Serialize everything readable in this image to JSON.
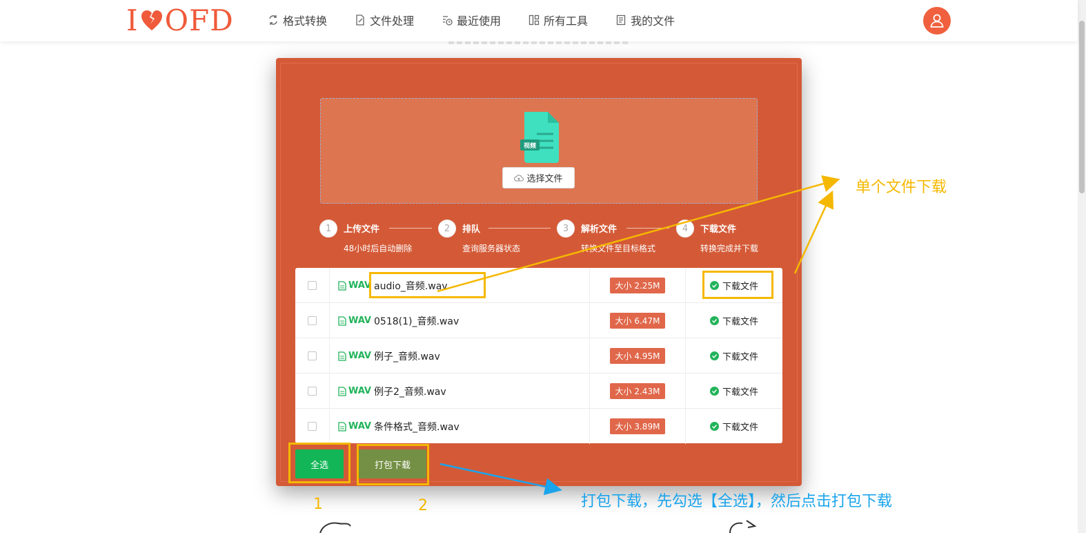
{
  "header": {
    "logo_left": "I",
    "logo_right": "OFD",
    "nav": [
      {
        "label": "格式转换",
        "icon": "convert-icon"
      },
      {
        "label": "文件处理",
        "icon": "file-edit-icon"
      },
      {
        "label": "最近使用",
        "icon": "history-icon"
      },
      {
        "label": "所有工具",
        "icon": "grid-icon"
      },
      {
        "label": "我的文件",
        "icon": "document-icon"
      }
    ],
    "avatar_icon": "user-icon"
  },
  "upload": {
    "file_badge": "视频",
    "select_button": "选择文件"
  },
  "steps": [
    {
      "num": "1",
      "title": "上传文件",
      "desc": "48小时后自动删除"
    },
    {
      "num": "2",
      "title": "排队",
      "desc": "查询服务器状态"
    },
    {
      "num": "3",
      "title": "解析文件",
      "desc": "转换文件至目标格式"
    },
    {
      "num": "4",
      "title": "下载文件",
      "desc": "转换完成并下载"
    }
  ],
  "files": [
    {
      "format": "WAV",
      "name": "audio_音频.wav",
      "size": "大小 2.25M",
      "action": "下载文件"
    },
    {
      "format": "WAV",
      "name": "0518(1)_音频.wav",
      "size": "大小 6.47M",
      "action": "下载文件"
    },
    {
      "format": "WAV",
      "name": "例子_音频.wav",
      "size": "大小 4.95M",
      "action": "下载文件"
    },
    {
      "format": "WAV",
      "name": "例子2_音频.wav",
      "size": "大小 2.43M",
      "action": "下载文件"
    },
    {
      "format": "WAV",
      "name": "条件格式_音频.wav",
      "size": "大小 3.89M",
      "action": "下载文件"
    }
  ],
  "buttons": {
    "select_all": "全选",
    "zip_download": "打包下载"
  },
  "annotations": {
    "single_download": "单个文件下载",
    "num1": "1",
    "num2": "2",
    "zip_hint": "打包下载，先勾选【全选】，然后点击打包下载"
  },
  "colors": {
    "brand": "#ef5a3a",
    "card": "#d45a37",
    "green": "#12b656",
    "annotation_orange": "#f5b800",
    "annotation_blue": "#1aa4ec"
  }
}
